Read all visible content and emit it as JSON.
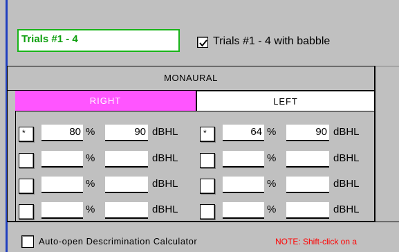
{
  "trials_field": {
    "value": "Trials #1 - 4"
  },
  "babble": {
    "checked": true,
    "label": "Trials #1 - 4 with babble"
  },
  "monaural": {
    "title": "MONAURAL",
    "right_tab": "RIGHT",
    "left_tab": "LEFT",
    "right_rows": [
      {
        "marker": "*",
        "percent": "80",
        "pct_unit": "%",
        "level": "90",
        "level_unit": "dBHL"
      },
      {
        "marker": "",
        "percent": "",
        "pct_unit": "%",
        "level": "",
        "level_unit": "dBHL"
      },
      {
        "marker": "",
        "percent": "",
        "pct_unit": "%",
        "level": "",
        "level_unit": "dBHL"
      },
      {
        "marker": "",
        "percent": "",
        "pct_unit": "%",
        "level": "",
        "level_unit": "dBHL"
      }
    ],
    "left_rows": [
      {
        "marker": "*",
        "percent": "64",
        "pct_unit": "%",
        "level": "90",
        "level_unit": "dBHL"
      },
      {
        "marker": "",
        "percent": "",
        "pct_unit": "%",
        "level": "",
        "level_unit": "dBHL"
      },
      {
        "marker": "",
        "percent": "",
        "pct_unit": "%",
        "level": "",
        "level_unit": "dBHL"
      },
      {
        "marker": "",
        "percent": "",
        "pct_unit": "%",
        "level": "",
        "level_unit": "dBHL"
      }
    ]
  },
  "footer": {
    "auto_open_label": "Auto-open Descrimination Calculator",
    "auto_open_checked": false,
    "note": "NOTE: Shift-click on a"
  },
  "colors": {
    "accent_blue": "#1f3fbf",
    "right_pink": "#ff55ff",
    "field_green": "#19b419",
    "note_red": "#ff0000"
  }
}
